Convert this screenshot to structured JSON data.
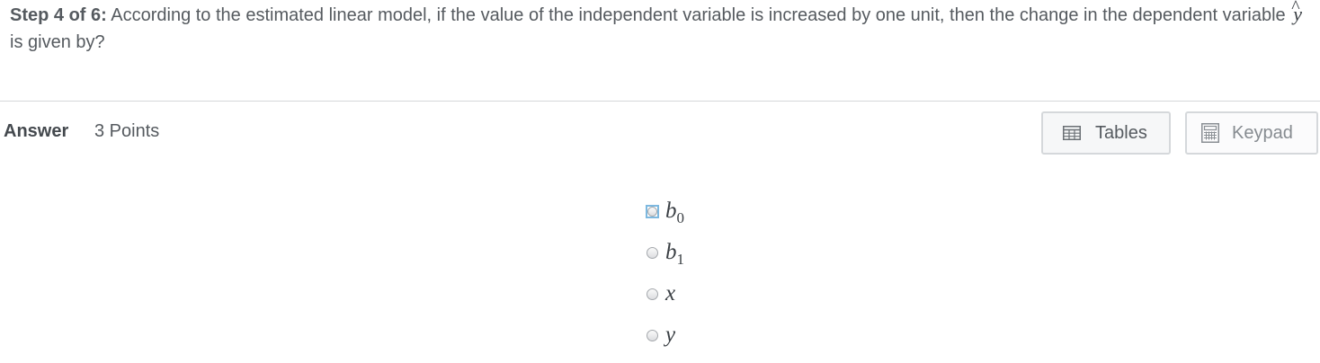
{
  "question": {
    "step_label": "Step 4 of 6:",
    "text_before": "According to the estimated linear model, if the value of the independent variable is increased by one unit, then the change in the dependent variable",
    "variable": "y",
    "variable_hat": "^",
    "text_after": "is given by?"
  },
  "answer": {
    "label": "Answer",
    "points": "3 Points"
  },
  "toolbar": {
    "tables_label": "Tables",
    "tables_icon": "table-icon",
    "keypad_label": "Keypad",
    "keypad_icon": "keypad-icon"
  },
  "options": [
    {
      "base": "b",
      "sub": "0",
      "selected": false,
      "focused": true
    },
    {
      "base": "b",
      "sub": "1",
      "selected": false,
      "focused": false
    },
    {
      "base": "x",
      "sub": "",
      "selected": false,
      "focused": false
    },
    {
      "base": "y",
      "sub": "",
      "selected": false,
      "focused": false
    }
  ],
  "colors": {
    "text": "#555a5f",
    "divider": "#d6d8da",
    "focus": "#7db8df"
  }
}
